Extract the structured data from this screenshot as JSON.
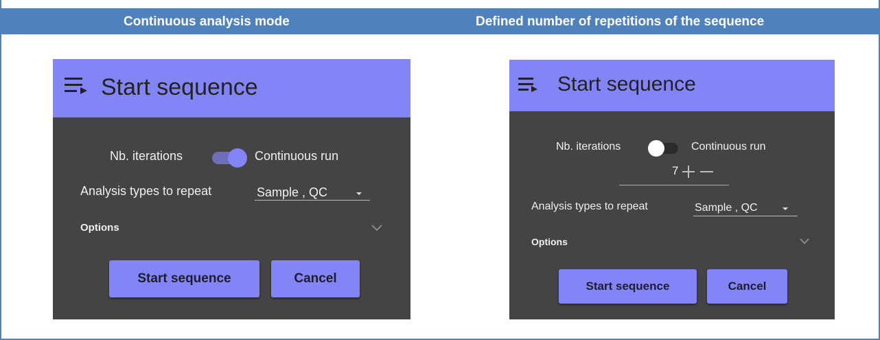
{
  "header": {
    "left_title": "Continuous analysis mode",
    "right_title": "Defined number of repetitions of the sequence"
  },
  "colors": {
    "band": "#4f81bd",
    "dialog_bg": "#444444",
    "accent": "#8385f7"
  },
  "dialog_left": {
    "icon": "playlist-play-icon",
    "title": "Start sequence",
    "toggle_left_label": "Nb. iterations",
    "toggle_right_label": "Continuous run",
    "toggle_state": "on",
    "analysis_label": "Analysis types to repeat",
    "analysis_value": "Sample , QC",
    "options_label": "Options",
    "start_button": "Start sequence",
    "cancel_button": "Cancel"
  },
  "dialog_right": {
    "icon": "playlist-play-icon",
    "title": "Start sequence",
    "toggle_left_label": "Nb. iterations",
    "toggle_right_label": "Continuous run",
    "toggle_state": "off",
    "iterations_value": "7",
    "analysis_label": "Analysis types to repeat",
    "analysis_value": "Sample , QC",
    "options_label": "Options",
    "start_button": "Start sequence",
    "cancel_button": "Cancel"
  }
}
